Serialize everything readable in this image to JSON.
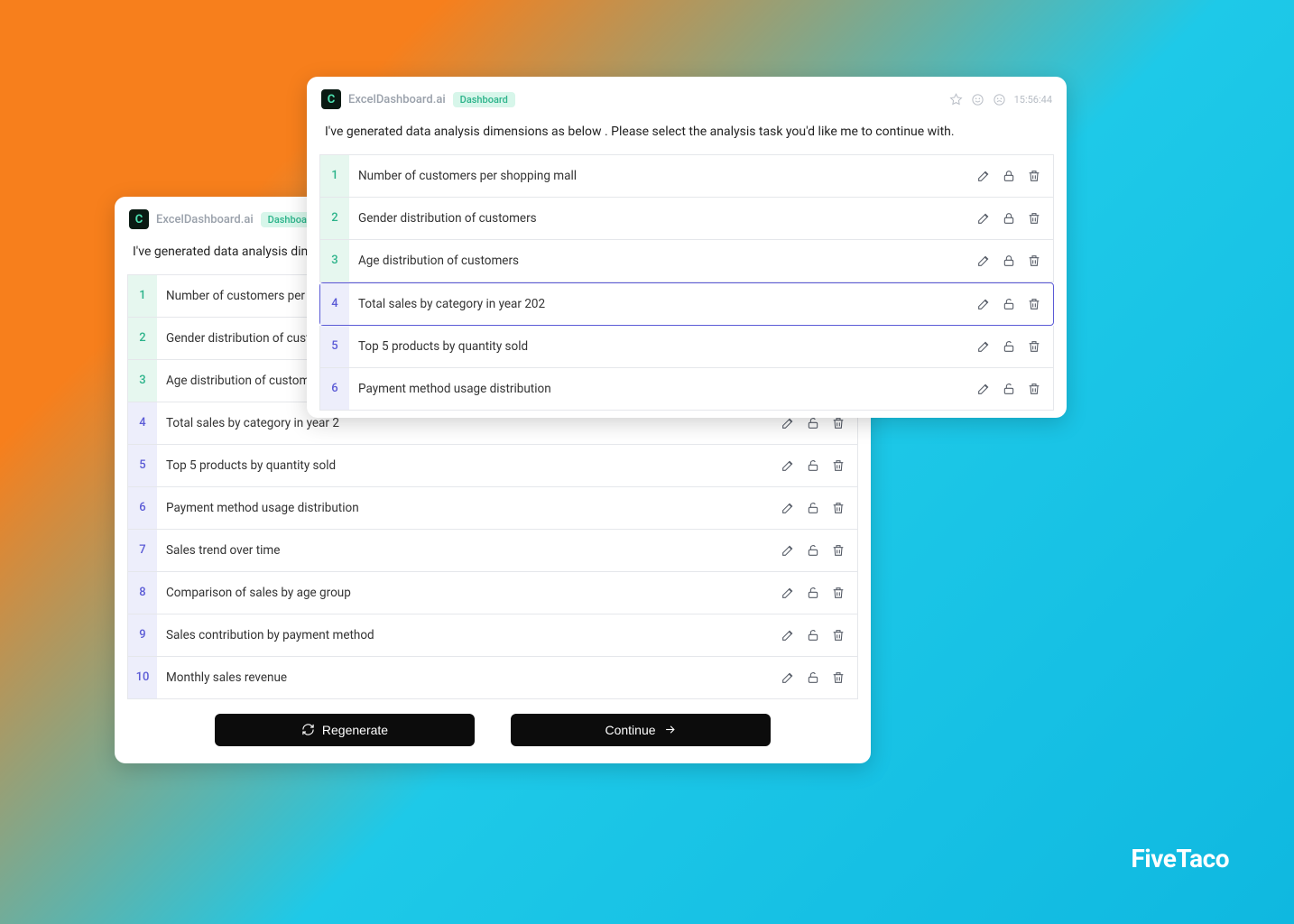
{
  "app_name": "ExcelDashboard.ai",
  "badge_label": "Dashboard",
  "timestamp": "15:56:44",
  "prompt_text": "I've generated data analysis dimensions as below . Please select the analysis task you'd like me to continue with.",
  "back_card": {
    "prompt_truncated": "I've generated data analysis dimens",
    "tasks": [
      {
        "n": "1",
        "label": "Number of customers per shopp",
        "color": "green",
        "locked": true
      },
      {
        "n": "2",
        "label": "Gender distribution of customers",
        "color": "green",
        "locked": true
      },
      {
        "n": "3",
        "label": "Age distribution of customers",
        "color": "green",
        "locked": true
      },
      {
        "n": "4",
        "label": "Total sales by category in year 2",
        "color": "purple",
        "locked": false
      },
      {
        "n": "5",
        "label": "Top 5 products by quantity sold",
        "color": "purple",
        "locked": false
      },
      {
        "n": "6",
        "label": "Payment method usage distribution",
        "color": "purple",
        "locked": false
      },
      {
        "n": "7",
        "label": "Sales trend over time",
        "color": "purple",
        "locked": false
      },
      {
        "n": "8",
        "label": "Comparison of sales by age group",
        "color": "purple",
        "locked": false
      },
      {
        "n": "9",
        "label": "Sales contribution by payment method",
        "color": "purple",
        "locked": false
      },
      {
        "n": "10",
        "label": "Monthly sales revenue",
        "color": "purple",
        "locked": false
      }
    ]
  },
  "front_card": {
    "tasks": [
      {
        "n": "1",
        "label": "Number of customers per shopping mall",
        "color": "green",
        "locked": true,
        "active": false
      },
      {
        "n": "2",
        "label": "Gender distribution of customers",
        "color": "green",
        "locked": true,
        "active": false
      },
      {
        "n": "3",
        "label": "Age distribution of customers",
        "color": "green",
        "locked": true,
        "active": false
      },
      {
        "n": "4",
        "label": "Total sales by category in year 202",
        "color": "purple",
        "locked": false,
        "active": true
      },
      {
        "n": "5",
        "label": "Top 5 products by quantity sold",
        "color": "purple",
        "locked": false,
        "active": false
      },
      {
        "n": "6",
        "label": "Payment method usage distribution",
        "color": "purple",
        "locked": false,
        "active": false
      }
    ]
  },
  "buttons": {
    "regenerate": "Regenerate",
    "continue": "Continue"
  },
  "watermark": "FiveTaco"
}
